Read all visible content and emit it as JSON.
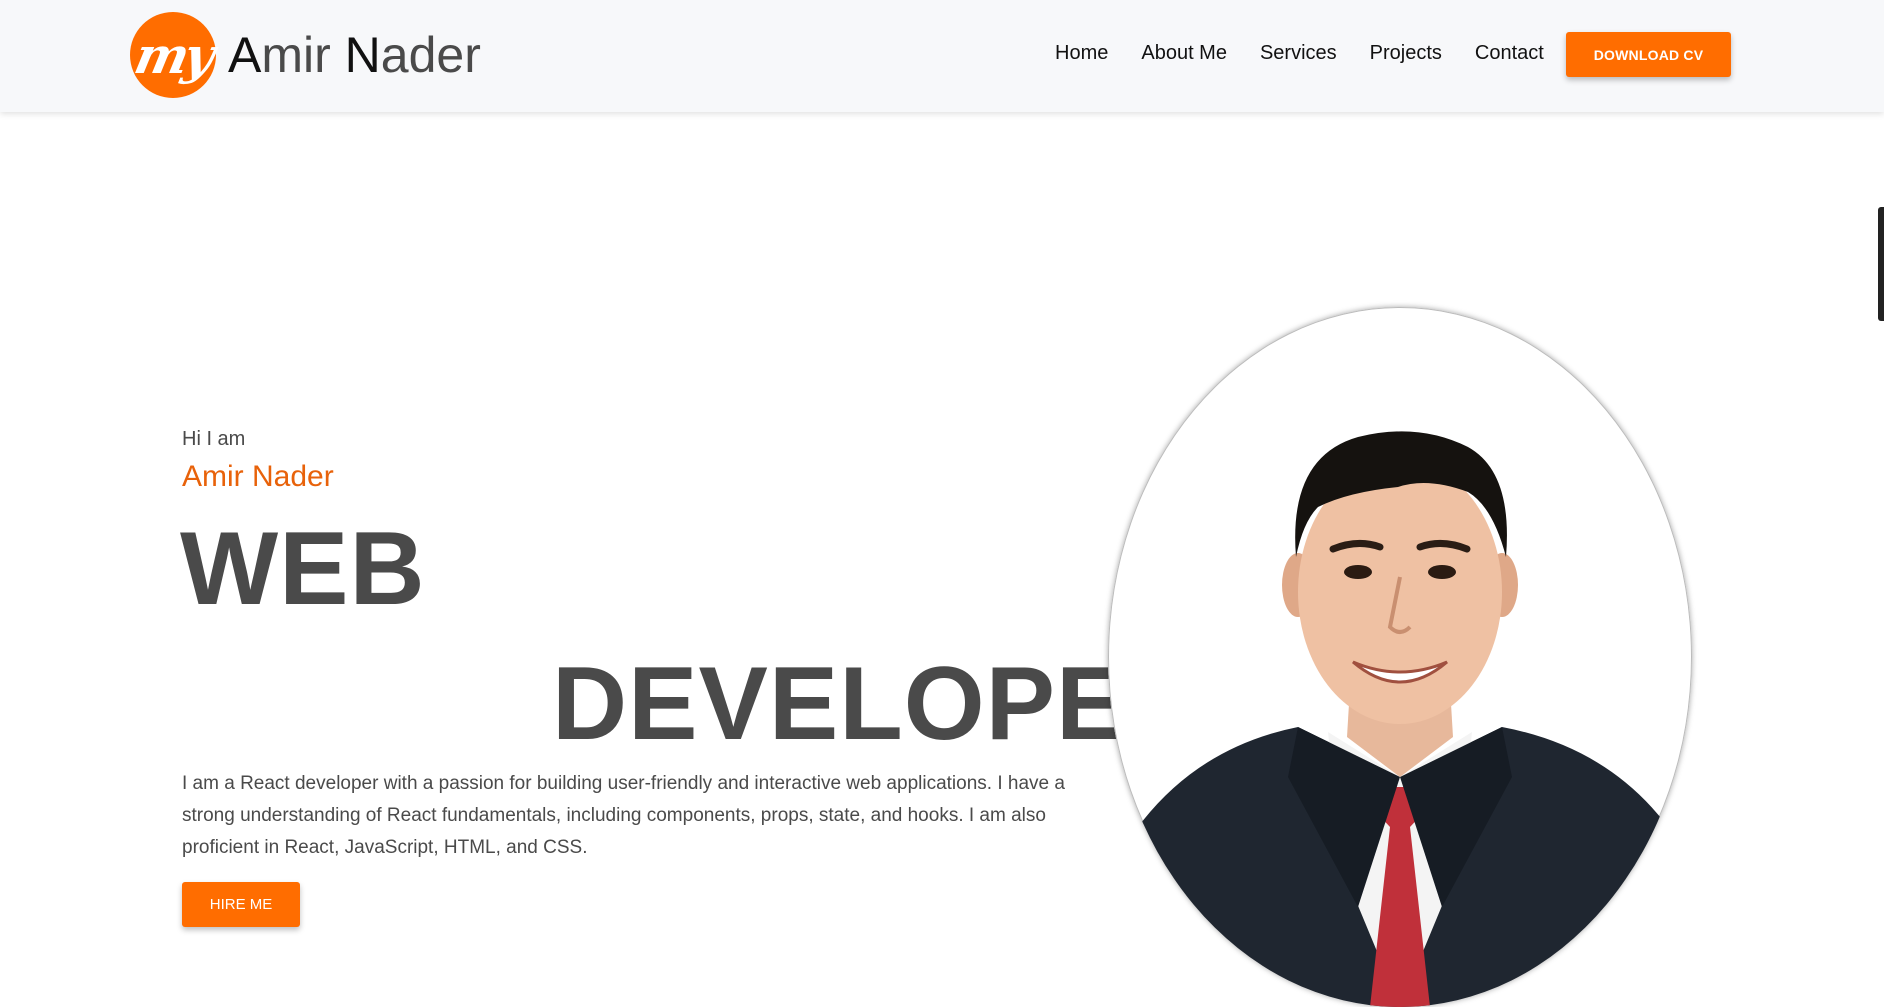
{
  "brand": {
    "mark": "my",
    "name_initial_1": "A",
    "name_rest_1": "mir ",
    "name_initial_2": "N",
    "name_rest_2": "ader"
  },
  "nav": {
    "items": [
      "Home",
      "About Me",
      "Services",
      "Projects",
      "Contact"
    ],
    "download_label": "DOWNLOAD CV"
  },
  "hero": {
    "greeting": "Hi I am",
    "name": "Amir Nader",
    "title_line1": "WEB",
    "title_line2": "DEVELOPER",
    "description": "I am a React developer with a passion for building user-friendly and interactive web applications. I have a strong understanding of React fundamentals, including components, props, state, and hooks. I am also proficient in React, JavaScript, HTML, and CSS.",
    "hire_label": "HIRE ME"
  },
  "colors": {
    "accent": "#ff6d00",
    "name_accent": "#e8620a",
    "text": "#4a4a4a"
  }
}
